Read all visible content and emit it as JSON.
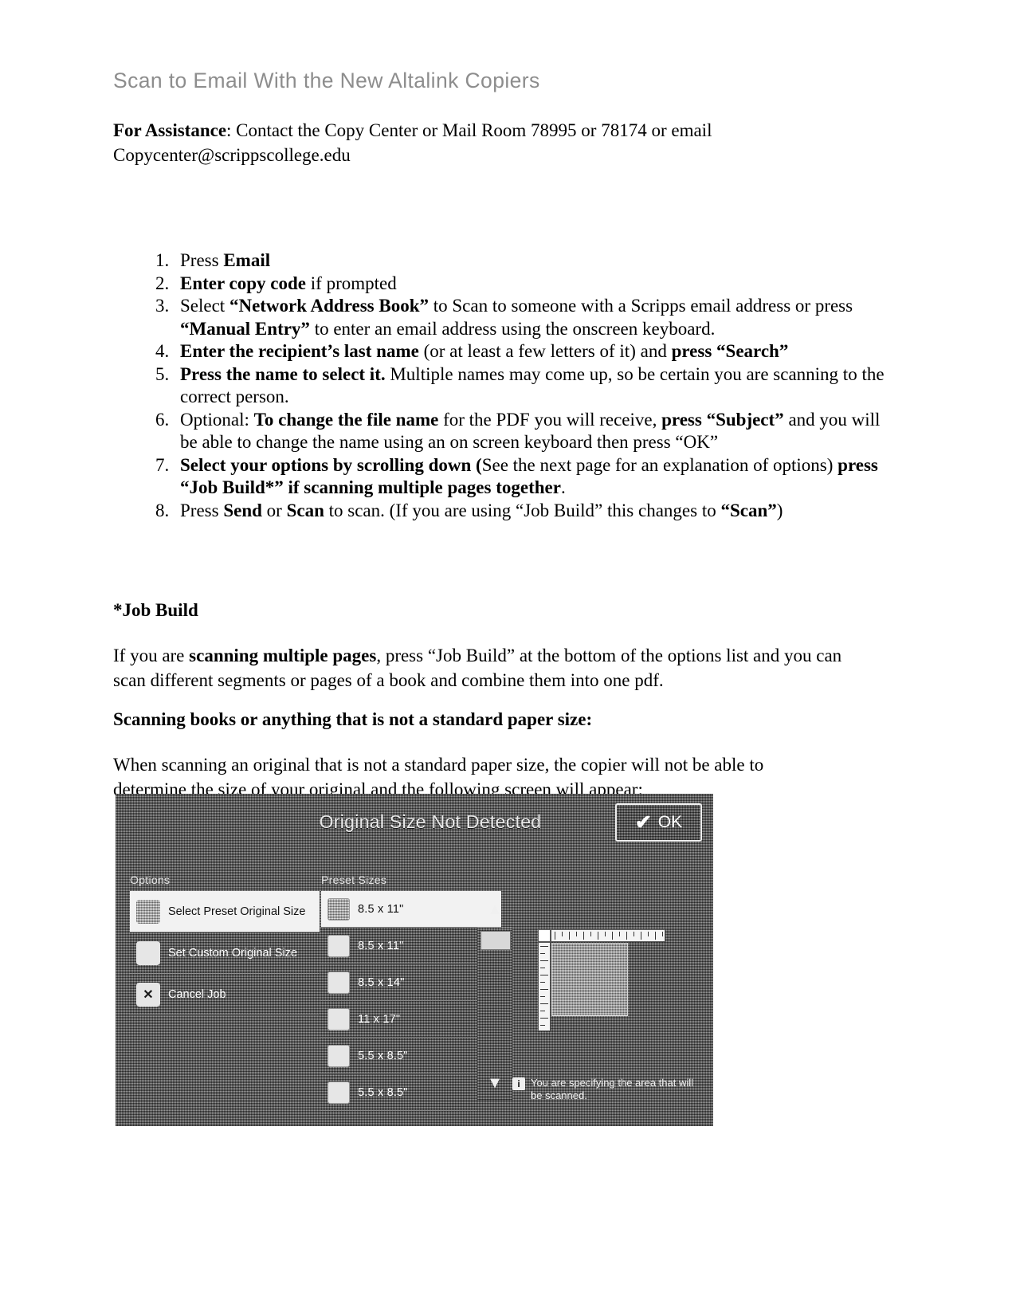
{
  "document": {
    "title": "Scan to Email With the New Altalink Copiers",
    "assistance": {
      "label": "For Assistance",
      "body": ": Contact the Copy Center or Mail Room 78995 or 78174 or email Copycenter@scrippscollege.edu"
    },
    "steps": [
      {
        "n": "1",
        "parts": [
          {
            "t": "Press ",
            "b": false
          },
          {
            "t": "Email",
            "b": true
          }
        ]
      },
      {
        "n": "2",
        "parts": [
          {
            "t": "Enter copy code",
            "b": true
          },
          {
            "t": " if prompted",
            "b": false
          }
        ]
      },
      {
        "n": "3",
        "parts": [
          {
            "t": "Select ",
            "b": false
          },
          {
            "t": "“Network Address Book”",
            "b": true
          },
          {
            "t": " to Scan to someone with a Scripps email address or press ",
            "b": false
          },
          {
            "t": "“Manual Entry”",
            "b": true
          },
          {
            "t": " to enter an email address using the onscreen keyboard.",
            "b": false
          }
        ]
      },
      {
        "n": "4",
        "parts": [
          {
            "t": "Enter the recipient’s last name",
            "b": true
          },
          {
            "t": " (or at least a few letters of it) and ",
            "b": false
          },
          {
            "t": "press “Search”",
            "b": true
          }
        ]
      },
      {
        "n": "5",
        "parts": [
          {
            "t": "Press the name to select it.",
            "b": true
          },
          {
            "t": "  Multiple names may come up, so be certain you are scanning to the correct person.",
            "b": false
          }
        ]
      },
      {
        "n": "6",
        "parts": [
          {
            "t": "Optional: ",
            "b": false
          },
          {
            "t": "To change the file name",
            "b": true
          },
          {
            "t": " for the PDF you will receive, ",
            "b": false
          },
          {
            "t": "press “Subject”",
            "b": true
          },
          {
            "t": " and you will be able to change the name using an on screen keyboard then press “OK”",
            "b": false
          }
        ]
      },
      {
        "n": "7",
        "parts": [
          {
            "t": "Select your options by scrolling down (",
            "b": true
          },
          {
            "t": "See the next page for an explanation of options) ",
            "b": false
          },
          {
            "t": "press “Job Build*” if scanning multiple pages together",
            "b": true
          },
          {
            "t": ".",
            "b": false
          }
        ]
      },
      {
        "n": "8",
        "parts": [
          {
            "t": "Press ",
            "b": false
          },
          {
            "t": "Send",
            "b": true
          },
          {
            "t": " or ",
            "b": false
          },
          {
            "t": "Scan",
            "b": true
          },
          {
            "t": " to scan.  (If you are using “Job Build” this changes to ",
            "b": false
          },
          {
            "t": "“Scan”",
            "b": true
          },
          {
            "t": ")",
            "b": false
          }
        ]
      }
    ],
    "job_build_heading": "*Job Build",
    "job_build_paragraph": {
      "pre": "If you are ",
      "bold": "scanning multiple pages",
      "post": ", press “Job Build” at the bottom of the options list and you can scan different segments or pages of a book and combine them into one pdf."
    },
    "books_heading": "Scanning books or anything that is not a standard paper size:",
    "books_paragraph": "When scanning an original that is not a standard paper size, the copier will not be able to determine the size of your original and the following screen will appear:"
  },
  "copier_screen": {
    "title": "Original Size Not Detected",
    "ok_button": {
      "label": "OK",
      "icon": "✔"
    },
    "options_label": "Options",
    "presets_label": "Preset Sizes",
    "options": [
      {
        "label": "Select Preset Original Size",
        "icon": "preset-size-icon",
        "selected": true
      },
      {
        "label": "Set Custom Original Size",
        "icon": "custom-size-icon",
        "selected": false
      },
      {
        "label": "Cancel Job",
        "icon": "cancel-x-icon",
        "selected": false
      }
    ],
    "preset_sizes": [
      {
        "label": "8.5 x 11\"",
        "selected": true
      },
      {
        "label": "8.5 x 11\"",
        "selected": false
      },
      {
        "label": "8.5 x 14\"",
        "selected": false
      },
      {
        "label": "11 x 17\"",
        "selected": false
      },
      {
        "label": "5.5 x 8.5\"",
        "selected": false
      },
      {
        "label": "5.5 x 8.5\"",
        "selected": false
      }
    ],
    "scroll": {
      "up_icon": "▲",
      "down_icon": "▼"
    },
    "hint": {
      "icon": "i",
      "text": "You are specifying the area that will be scanned."
    }
  }
}
